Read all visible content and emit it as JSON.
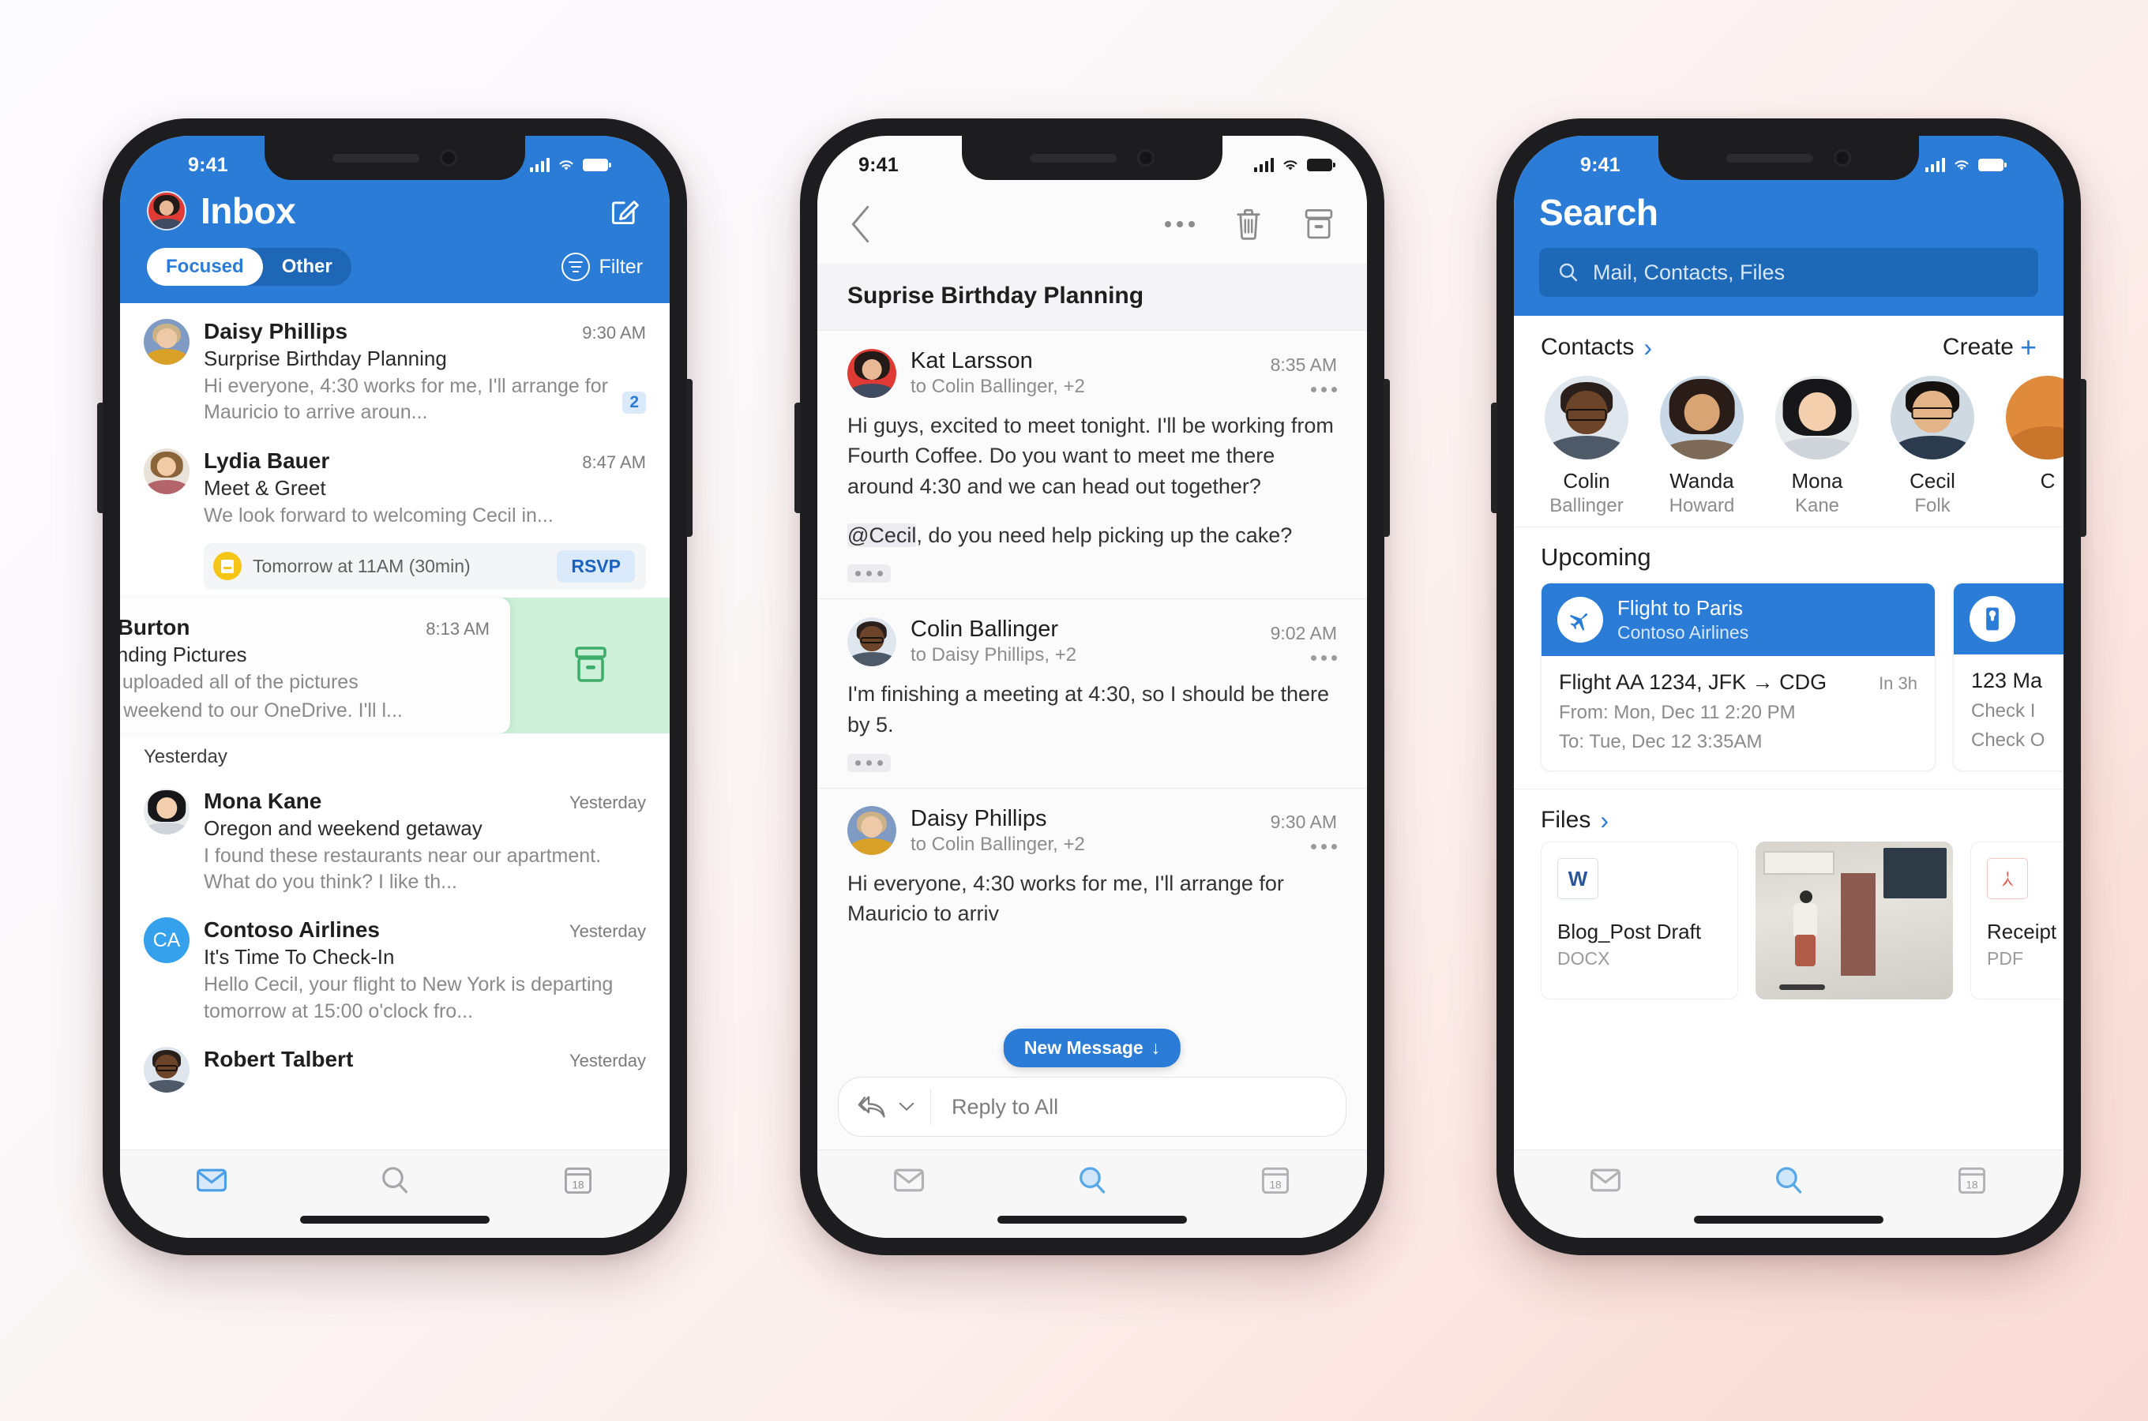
{
  "status_bar": {
    "time": "9:41",
    "signal_icon": "cellular-bars-icon",
    "wifi_icon": "wifi-icon",
    "battery_icon": "battery-full-icon"
  },
  "colors": {
    "brand_blue": "#2b7cd6",
    "pivot_inactive_bg": "#1e66b6",
    "swipe_archive_green": "#cdf0d8",
    "unread_badge_bg": "#dbeafb",
    "calendar_yellow": "#f5c518",
    "word_blue": "#2b579a",
    "pdf_red": "#e2574c"
  },
  "phone1": {
    "header": {
      "title": "Inbox",
      "avatar_name": "user-avatar",
      "compose_label": "compose-icon",
      "pivots": [
        {
          "label": "Focused",
          "active": true
        },
        {
          "label": "Other",
          "active": false
        }
      ],
      "filter_label": "Filter"
    },
    "messages": [
      {
        "sender": "Daisy Phillips",
        "time": "9:30 AM",
        "subject": "Surprise Birthday Planning",
        "preview": "Hi everyone, 4:30 works for me, I'll arrange for Mauricio to arrive aroun...",
        "count": "2"
      },
      {
        "sender": "Lydia Bauer",
        "time": "8:47 AM",
        "subject": "Meet & Greet",
        "preview": "We look forward to welcoming Cecil in...",
        "event": {
          "text": "Tomorrow at 11AM (30min)",
          "action": "RSVP"
        }
      },
      {
        "sender": "te Burton",
        "time": "8:13 AM",
        "subject": "Bonding Pictures",
        "preview_line1": "il, I uploaded all of the pictures",
        "preview_line2": "ast weekend to our OneDrive. I'll l...",
        "swipe_action": "archive-icon"
      }
    ],
    "day_separator": "Yesterday",
    "messages_yesterday": [
      {
        "sender": "Mona Kane",
        "time": "Yesterday",
        "subject": "Oregon and weekend getaway",
        "preview": "I found these restaurants near our apartment. What do you think? I like th..."
      },
      {
        "sender": "Contoso Airlines",
        "initials": "CA",
        "time": "Yesterday",
        "subject": "It's Time To Check-In",
        "preview": "Hello Cecil, your flight to New York is departing tomorrow at 15:00 o'clock fro..."
      },
      {
        "sender": "Robert Talbert",
        "time": "Yesterday"
      }
    ],
    "tabs": [
      {
        "name": "mail-tab",
        "icon": "envelope-icon",
        "active": true
      },
      {
        "name": "search-tab",
        "icon": "search-icon",
        "active": false
      },
      {
        "name": "calendar-tab",
        "icon": "calendar-18-icon",
        "active": false
      }
    ]
  },
  "phone2": {
    "nav": {
      "back_icon": "chevron-left-icon",
      "more_icon": "more-horizontal-icon",
      "delete_icon": "trash-icon",
      "archive_icon": "archive-icon"
    },
    "subject": "Suprise Birthday Planning",
    "messages": [
      {
        "sender": "Kat Larsson",
        "recipients": "to Colin Ballinger, +2",
        "time": "8:35 AM",
        "body1": "Hi guys, excited to meet tonight. I'll be working from Fourth Coffee. Do you want to meet me there around 4:30 and we can head out together?",
        "mention": "@Cecil",
        "body2": ", do you need help picking up the cake?",
        "has_ellipsis": true
      },
      {
        "sender": "Colin Ballinger",
        "recipients": "to Daisy Phillips, +2",
        "time": "9:02 AM",
        "body1": "I'm finishing a meeting at 4:30, so I should be there by 5.",
        "has_ellipsis": true
      },
      {
        "sender": "Daisy Phillips",
        "recipients": "to Colin Ballinger, +2",
        "time": "9:30 AM",
        "body1": "Hi everyone, 4:30 works for me, I'll arrange for Mauricio to arriv",
        "has_ellipsis": false
      }
    ],
    "new_message_pill": "New Message",
    "reply": {
      "placeholder": "Reply to All",
      "reply_icon": "reply-all-icon",
      "chevron": "chevron-down-icon"
    },
    "tabs": [
      {
        "name": "mail-tab",
        "icon": "envelope-icon",
        "active": false
      },
      {
        "name": "search-tab",
        "icon": "search-icon",
        "active": true
      },
      {
        "name": "calendar-tab",
        "icon": "calendar-18-icon",
        "active": false
      }
    ]
  },
  "phone3": {
    "header": {
      "title": "Search",
      "search_placeholder": "Mail, Contacts, Files",
      "search_icon": "search-icon"
    },
    "contacts_section": {
      "label": "Contacts",
      "chevron": "›",
      "create_label": "Create",
      "create_icon": "plus-icon"
    },
    "contacts": [
      {
        "first": "Colin",
        "last": "Ballinger"
      },
      {
        "first": "Wanda",
        "last": "Howard"
      },
      {
        "first": "Mona",
        "last": "Kane"
      },
      {
        "first": "Cecil",
        "last": "Folk"
      },
      {
        "first": "C",
        "last": ""
      }
    ],
    "upcoming_label": "Upcoming",
    "upcoming": [
      {
        "icon": "airplane-icon",
        "title": "Flight to Paris",
        "subtitle": "Contoso Airlines",
        "main": "Flight AA 1234, JFK → CDG",
        "when": "In 3h",
        "line1": "From: Mon, Dec 11 2:20 PM",
        "line2": "To: Tue, Dec 12 3:35AM"
      },
      {
        "icon": "door-hanger-icon",
        "title": "",
        "subtitle": "",
        "main": "123 Ma",
        "when": "",
        "line1": "Check I",
        "line2": "Check O"
      }
    ],
    "files_section": {
      "label": "Files",
      "chevron": "›"
    },
    "files": [
      {
        "kind": "doc",
        "badge": "W",
        "name": "Blog_Post Draft",
        "type": "DOCX"
      },
      {
        "kind": "image",
        "badge": "",
        "name": "",
        "type": ""
      },
      {
        "kind": "doc",
        "badge": "✓",
        "name": "Receipt",
        "type": "PDF"
      }
    ],
    "tabs": [
      {
        "name": "mail-tab",
        "icon": "envelope-icon",
        "active": false
      },
      {
        "name": "search-tab",
        "icon": "search-icon",
        "active": true
      },
      {
        "name": "calendar-tab",
        "icon": "calendar-18-icon",
        "active": false
      }
    ]
  }
}
